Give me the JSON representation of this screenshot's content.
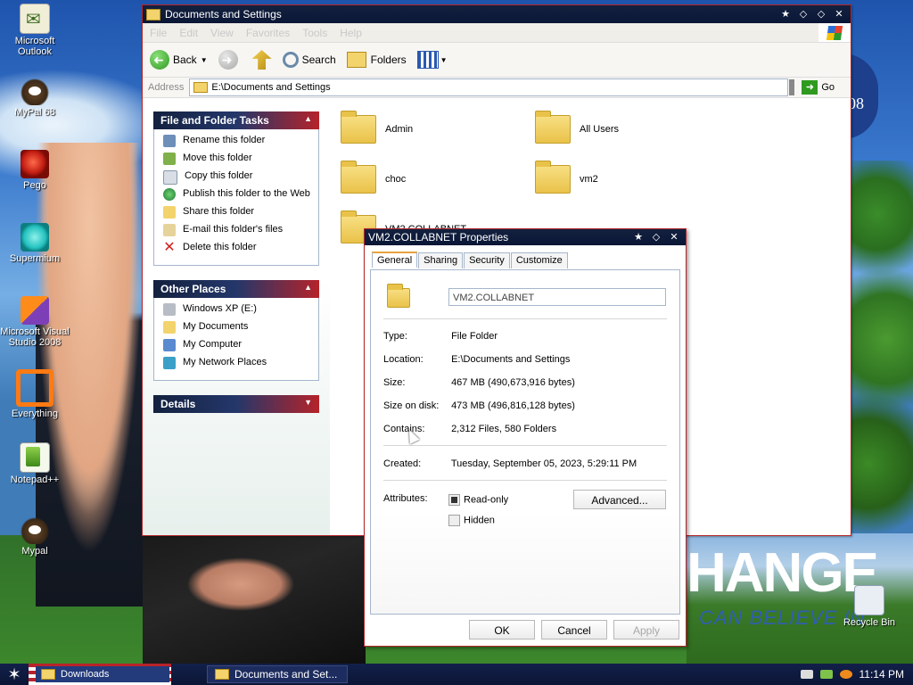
{
  "desktop": {
    "icons": [
      {
        "label": "Microsoft Outlook",
        "icon": "outlook-icon"
      },
      {
        "label": "MyPal 68",
        "icon": "mypal-icon"
      },
      {
        "label": "Pego",
        "icon": "pego-icon"
      },
      {
        "label": "Supermium",
        "icon": "supermium-icon"
      },
      {
        "label": "Microsoft Visual Studio 2008",
        "icon": "visual-studio-icon"
      },
      {
        "label": "Everything",
        "icon": "everything-icon"
      },
      {
        "label": "Notepad++",
        "icon": "notepad-plus-plus-icon"
      },
      {
        "label": "Mypal",
        "icon": "mypal-icon"
      }
    ],
    "recycle_bin": "Recycle Bin",
    "wallpaper_text": "HANGE",
    "wallpaper_subtext": "CAN BELIEVE IN",
    "seal_text": "08"
  },
  "explorer": {
    "title": "Documents and Settings",
    "menu": [
      "File",
      "Edit",
      "View",
      "Favorites",
      "Tools",
      "Help"
    ],
    "toolbar": {
      "back": "Back",
      "search": "Search",
      "folders": "Folders"
    },
    "address_label": "Address",
    "address_value": "E:\\Documents and Settings",
    "go_label": "Go",
    "file_tasks": {
      "title": "File and Folder Tasks",
      "items": [
        "Rename this folder",
        "Move this folder",
        "Copy this folder",
        "Publish this folder to the Web",
        "Share this folder",
        "E-mail this folder's files",
        "Delete this folder"
      ]
    },
    "other_places": {
      "title": "Other Places",
      "items": [
        "Windows XP (E:)",
        "My Documents",
        "My Computer",
        "My Network Places"
      ]
    },
    "details": {
      "title": "Details"
    },
    "folders": [
      "Admin",
      "All Users",
      "choc",
      "vm2",
      "VM2.COLLABNET"
    ]
  },
  "properties": {
    "title": "VM2.COLLABNET Properties",
    "tabs": [
      "General",
      "Sharing",
      "Security",
      "Customize"
    ],
    "folder_name": "VM2.COLLABNET",
    "type_label": "Type:",
    "type_value": "File Folder",
    "location_label": "Location:",
    "location_value": "E:\\Documents and Settings",
    "size_label": "Size:",
    "size_value": "467 MB (490,673,916 bytes)",
    "size_on_disk_label": "Size on disk:",
    "size_on_disk_value": "473 MB (496,816,128 bytes)",
    "contains_label": "Contains:",
    "contains_value": "2,312 Files, 580 Folders",
    "created_label": "Created:",
    "created_value": "Tuesday, September 05, 2023, 5:29:11 PM",
    "attributes_label": "Attributes:",
    "read_only_label": "Read-only",
    "read_only_checked": true,
    "hidden_label": "Hidden",
    "hidden_checked": false,
    "advanced_label": "Advanced...",
    "ok_label": "OK",
    "cancel_label": "Cancel",
    "apply_label": "Apply"
  },
  "taskbar": {
    "quick_item": "Downloads",
    "active_window": "Documents and Set...",
    "clock": "11:14 PM"
  },
  "colors": {
    "titlebar": "#0a1636",
    "accent_red": "#b3262b",
    "folder_yellow": "#e9c249"
  }
}
